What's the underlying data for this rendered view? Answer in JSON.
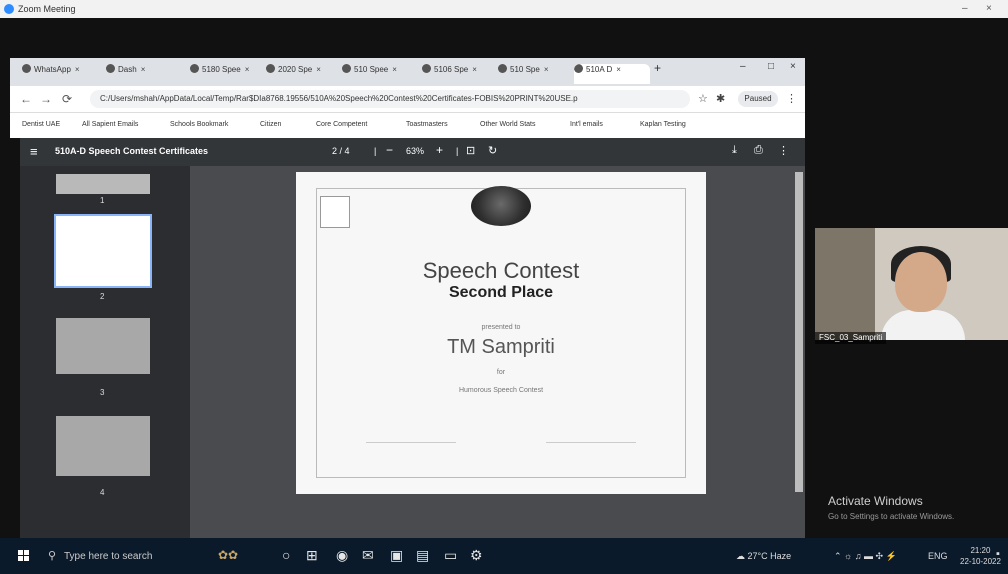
{
  "zoom": {
    "title": "Zoom Meeting"
  },
  "browser": {
    "tabs": [
      {
        "label": "WhatsApp"
      },
      {
        "label": "Dash"
      },
      {
        "label": "5180 Spee"
      },
      {
        "label": "2020 Spe"
      },
      {
        "label": "510 Spee"
      },
      {
        "label": "5106 Spe"
      },
      {
        "label": "510 Spe"
      },
      {
        "label": "510A D"
      }
    ],
    "url": "C:/Users/mshah/AppData/Local/Temp/Rar$DIa8768.19556/510A%20Speech%20Contest%20Certificates-FOBIS%20PRINT%20USE.p",
    "profile": "Paused",
    "bookmarks": [
      "Dentist UAE",
      "All Sapient Emails",
      "Schools Bookmark",
      "Citizen",
      "Core Competent",
      "Toastmasters",
      "Other World Stats",
      "Int'l emails",
      "Kaplan Testing"
    ]
  },
  "pdf": {
    "doc_title": "510A-D Speech Contest Certificates",
    "page_indicator": "2 / 4",
    "zoom_level": "63%",
    "thumbnails": [
      "1",
      "2",
      "3",
      "4"
    ]
  },
  "certificate": {
    "title": "Speech Contest",
    "place": "Second Place",
    "presented": "presented to",
    "name": "TM Sampriti",
    "for": "for",
    "event": "Humorous Speech Contest"
  },
  "video": {
    "participant": "FSC_03_Sampriti"
  },
  "watermark": {
    "line1": "Activate Windows",
    "line2": "Go to Settings to activate Windows."
  },
  "taskbar": {
    "search_placeholder": "Type here to search",
    "weather": "27°C Haze",
    "language": "ENG",
    "time": "21:20",
    "date": "22-10-2022"
  }
}
